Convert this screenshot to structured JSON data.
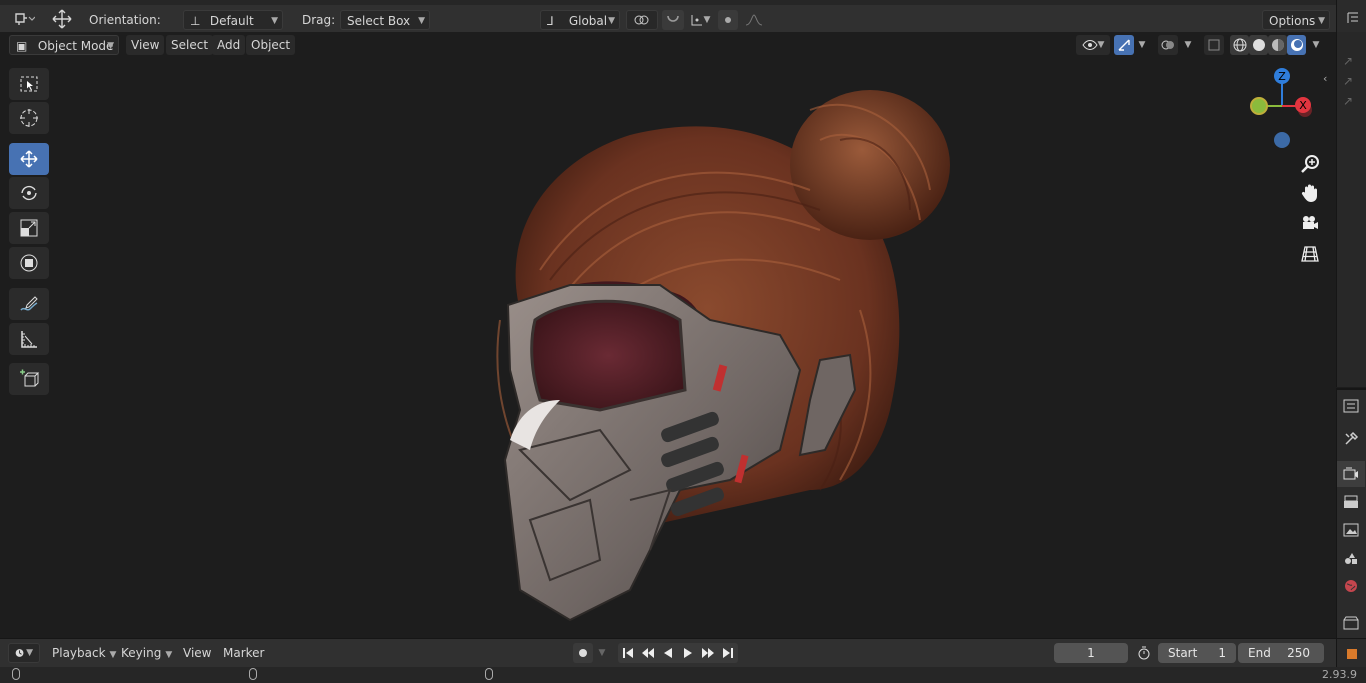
{
  "colors": {
    "accent": "#4772b3",
    "viewport_bg": "#1d1d1d",
    "header_bg": "#303030",
    "axis_x": "#e2353f",
    "axis_y": "#8bbb3c",
    "axis_z": "#2f7ddb",
    "axis_neg_z": "#3c6aa6"
  },
  "header": {
    "orientation_label": "Orientation:",
    "orientation_value": "Default",
    "drag_label": "Drag:",
    "drag_value": "Select Box",
    "transform_space": "Global",
    "options_label": "Options"
  },
  "viewport_header": {
    "mode": "Object Mode",
    "menus": [
      "View",
      "Select",
      "Add",
      "Object"
    ]
  },
  "toolbar": {
    "tools": [
      {
        "name": "select-box-icon"
      },
      {
        "name": "cursor-icon"
      },
      {
        "name": "move-icon",
        "active": true
      },
      {
        "name": "rotate-icon"
      },
      {
        "name": "scale-icon"
      },
      {
        "name": "transform-icon"
      },
      {
        "name": "annotate-icon"
      },
      {
        "name": "measure-icon"
      },
      {
        "name": "add-cube-icon"
      }
    ]
  },
  "gizmo": {
    "x_label": "X",
    "z_label": "Z"
  },
  "nav_icons": [
    "zoom-icon",
    "pan-hand-icon",
    "camera-icon",
    "grid-icon"
  ],
  "properties_tabs": [
    "tool-icon",
    "render-icon",
    "output-icon",
    "view-layer-icon",
    "scene-icon",
    "world-icon",
    "object-icon"
  ],
  "timeline": {
    "menus": [
      "Playback",
      "Keying",
      "View",
      "Marker"
    ],
    "current_frame": "1",
    "start_label": "Start",
    "start_value": "1",
    "end_label": "End",
    "end_value": "250"
  },
  "status": {
    "version": "2.93.9"
  }
}
